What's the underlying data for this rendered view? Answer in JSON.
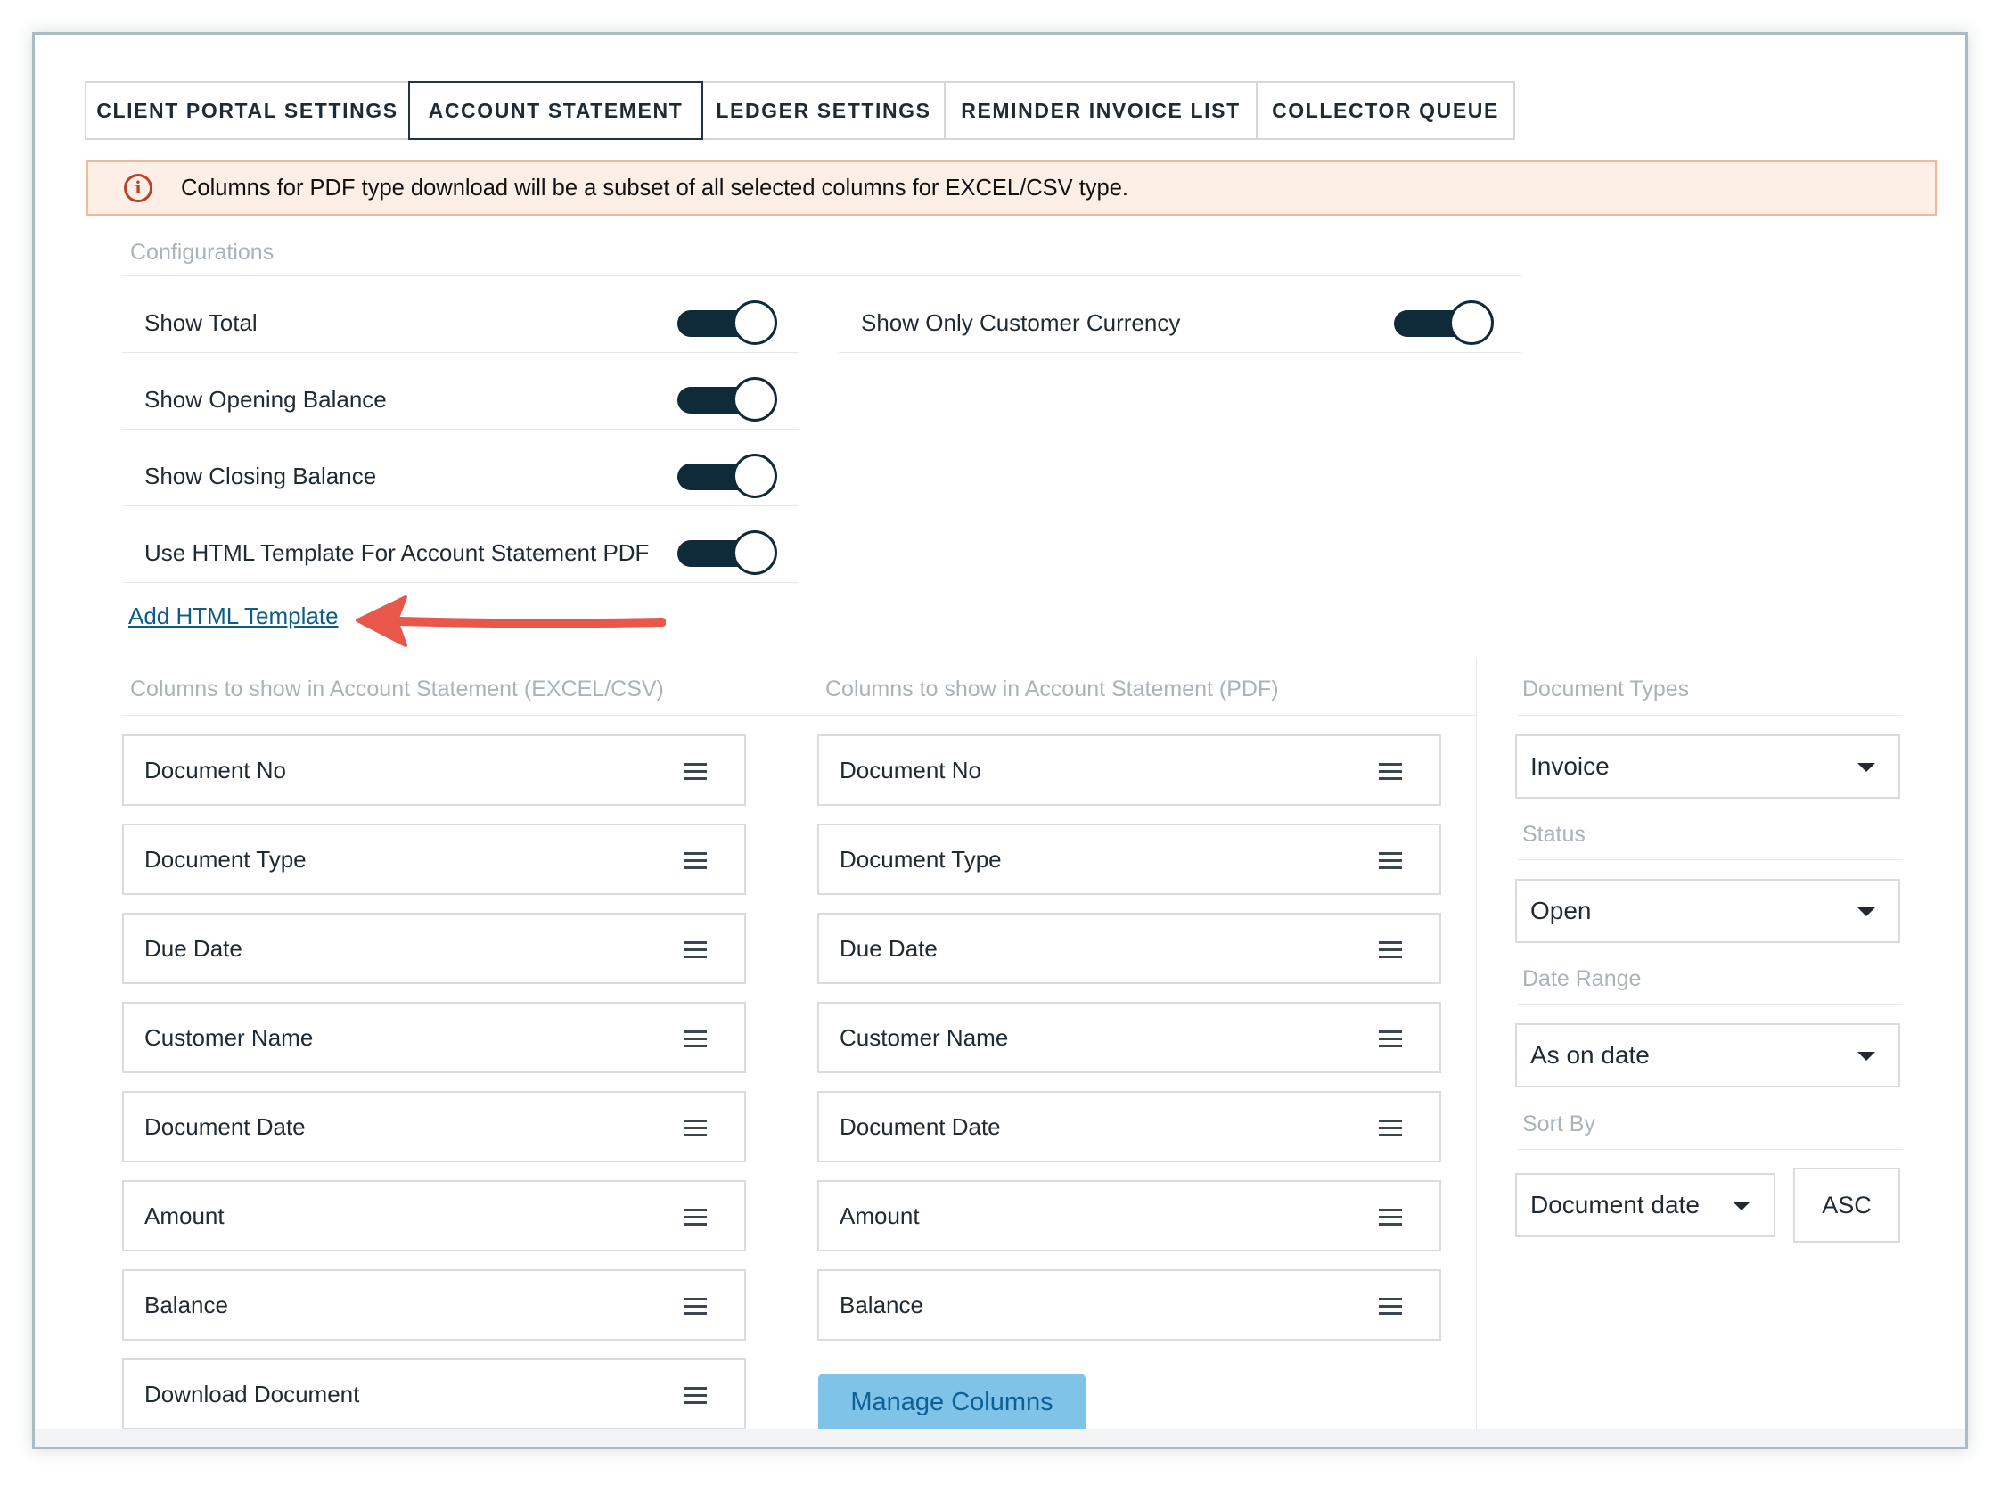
{
  "tabs": [
    {
      "label": "CLIENT PORTAL SETTINGS"
    },
    {
      "label": "ACCOUNT STATEMENT"
    },
    {
      "label": "LEDGER SETTINGS"
    },
    {
      "label": "REMINDER INVOICE LIST"
    },
    {
      "label": "COLLECTOR QUEUE"
    }
  ],
  "active_tab": "ACCOUNT STATEMENT",
  "alert": {
    "icon": "info-icon",
    "text": "Columns for PDF type download will be a subset of all selected columns for EXCEL/CSV type."
  },
  "configurations": {
    "title": "Configurations",
    "toggles": [
      {
        "label": "Show Total",
        "on": true
      },
      {
        "label": "Show Opening Balance",
        "on": true
      },
      {
        "label": "Show Closing Balance",
        "on": true
      },
      {
        "label": "Use HTML Template For Account Statement PDF",
        "on": true
      },
      {
        "label": "Show Only Customer Currency",
        "on": true
      }
    ]
  },
  "add_html_template_link": "Add HTML Template",
  "excel_columns": {
    "title": "Columns to show in Account Statement (EXCEL/CSV)",
    "items": [
      "Document No",
      "Document Type",
      "Due Date",
      "Customer Name",
      "Document Date",
      "Amount",
      "Balance",
      "Download Document"
    ]
  },
  "pdf_columns": {
    "title": "Columns to show in Account Statement (PDF)",
    "items": [
      "Document No",
      "Document Type",
      "Due Date",
      "Customer Name",
      "Document Date",
      "Amount",
      "Balance"
    ],
    "manage_button": "Manage Columns"
  },
  "filters": {
    "document_types": {
      "label": "Document Types",
      "value": "Invoice"
    },
    "status": {
      "label": "Status",
      "value": "Open"
    },
    "date_range": {
      "label": "Date Range",
      "value": "As on date"
    },
    "sort_by": {
      "label": "Sort By",
      "value": "Document date",
      "order": "ASC"
    }
  },
  "colors": {
    "toggle_on": "#0f2a38",
    "alert_bg": "#fdeee6",
    "alert_border": "#f3b89c",
    "annotation_arrow": "#e8574a",
    "link": "#0f5c85",
    "manage_button_bg": "#7fc3e8"
  }
}
